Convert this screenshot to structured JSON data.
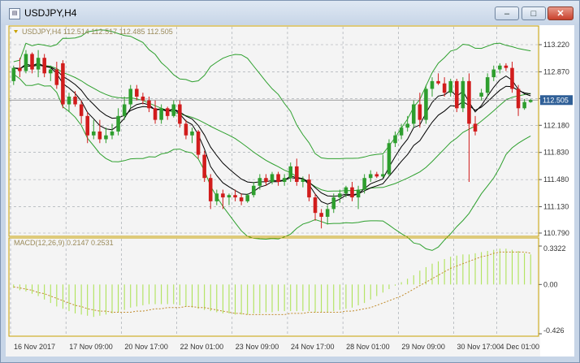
{
  "window": {
    "title": "USDJPY,H4",
    "icon": "chart-window-icon",
    "buttons": [
      "minimize-icon",
      "maximize-icon",
      "close-icon"
    ]
  },
  "main_legend": "USDJPY,H4  112.514 112.517 112.485 112.505",
  "macd_legend": "MACD(12,26,9) 0.2147 0.2531",
  "colors": {
    "bull": "#2e9e2e",
    "bear": "#d11c1c",
    "bands": "#2ea02e",
    "ma": "#000000",
    "macd_hist": "#a8e14a",
    "macd_signal": "#c08a2a",
    "frame": "#c8a000",
    "price_tag": "#2f5f97"
  },
  "chart_data": [
    {
      "type": "candlestick",
      "symbol": "USDJPY",
      "timeframe": "H4",
      "ylim": [
        110.79,
        113.22
      ],
      "yticks": [
        "113.220",
        "112.870",
        "112.525",
        "112.180",
        "111.830",
        "111.480",
        "111.130",
        "110.790"
      ],
      "x_labels": [
        "16 Nov 2017",
        "17 Nov 09:00",
        "20 Nov 17:00",
        "22 Nov 01:00",
        "23 Nov 09:00",
        "24 Nov 17:00",
        "28 Nov 01:00",
        "29 Nov 09:00",
        "30 Nov 17:00",
        "4 Dec 01:00"
      ],
      "current_price": "112.505",
      "grid": true,
      "indicators": [
        "Bollinger Bands",
        "Moving Average",
        "Moving Average"
      ],
      "candles": [
        [
          112.75,
          112.95,
          112.7,
          112.92
        ],
        [
          112.92,
          113.05,
          112.8,
          112.88
        ],
        [
          112.88,
          113.15,
          112.85,
          113.1
        ],
        [
          113.1,
          113.12,
          112.85,
          112.9
        ],
        [
          112.9,
          113.15,
          112.8,
          113.05
        ],
        [
          113.05,
          113.1,
          112.8,
          112.85
        ],
        [
          112.85,
          112.95,
          112.75,
          112.9
        ],
        [
          112.9,
          113.0,
          112.65,
          112.7
        ],
        [
          112.98,
          113.02,
          112.4,
          112.45
        ],
        [
          112.45,
          112.6,
          112.35,
          112.55
        ],
        [
          112.55,
          112.62,
          112.42,
          112.45
        ],
        [
          112.45,
          112.5,
          112.2,
          112.3
        ],
        [
          112.3,
          112.35,
          111.95,
          112.05
        ],
        [
          112.05,
          112.25,
          112.0,
          112.1
        ],
        [
          112.1,
          112.25,
          111.95,
          112.0
        ],
        [
          112.0,
          112.15,
          111.95,
          112.05
        ],
        [
          112.05,
          112.2,
          112.0,
          112.1
        ],
        [
          112.1,
          112.4,
          112.05,
          112.3
        ],
        [
          112.3,
          112.55,
          112.25,
          112.45
        ],
        [
          112.45,
          112.7,
          112.4,
          112.65
        ],
        [
          112.65,
          112.7,
          112.5,
          112.55
        ],
        [
          112.55,
          112.6,
          112.45,
          112.5
        ],
        [
          112.5,
          112.55,
          112.35,
          112.4
        ],
        [
          112.4,
          112.5,
          112.2,
          112.25
        ],
        [
          112.25,
          112.45,
          112.2,
          112.4
        ],
        [
          112.4,
          112.42,
          112.25,
          112.3
        ],
        [
          112.3,
          112.5,
          112.28,
          112.45
        ],
        [
          112.45,
          112.5,
          112.15,
          112.2
        ],
        [
          112.2,
          112.25,
          112.0,
          112.05
        ],
        [
          112.05,
          112.15,
          111.95,
          112.1
        ],
        [
          112.1,
          112.12,
          111.75,
          111.8
        ],
        [
          111.8,
          111.85,
          111.45,
          111.5
        ],
        [
          111.5,
          111.55,
          111.1,
          111.2
        ],
        [
          111.2,
          111.35,
          111.15,
          111.3
        ],
        [
          111.3,
          111.35,
          111.1,
          111.25
        ],
        [
          111.25,
          111.3,
          111.15,
          111.28
        ],
        [
          111.28,
          111.35,
          111.2,
          111.25
        ],
        [
          111.25,
          111.3,
          111.15,
          111.2
        ],
        [
          111.2,
          111.3,
          111.18,
          111.28
        ],
        [
          111.28,
          111.45,
          111.25,
          111.4
        ],
        [
          111.4,
          111.55,
          111.35,
          111.5
        ],
        [
          111.5,
          111.55,
          111.4,
          111.45
        ],
        [
          111.45,
          111.58,
          111.42,
          111.55
        ],
        [
          111.55,
          111.58,
          111.4,
          111.45
        ],
        [
          111.45,
          111.55,
          111.4,
          111.5
        ],
        [
          111.5,
          111.7,
          111.45,
          111.65
        ],
        [
          111.65,
          111.75,
          111.4,
          111.45
        ],
        [
          111.45,
          111.52,
          111.38,
          111.48
        ],
        [
          111.48,
          111.55,
          111.2,
          111.25
        ],
        [
          111.25,
          111.3,
          110.95,
          111.05
        ],
        [
          111.05,
          111.1,
          110.85,
          111.0
        ],
        [
          111.0,
          111.15,
          110.9,
          111.1
        ],
        [
          111.1,
          111.3,
          111.05,
          111.25
        ],
        [
          111.25,
          111.35,
          111.18,
          111.3
        ],
        [
          111.3,
          111.4,
          111.25,
          111.38
        ],
        [
          111.38,
          111.45,
          111.2,
          111.25
        ],
        [
          111.25,
          111.4,
          111.1,
          111.35
        ],
        [
          111.35,
          111.55,
          111.3,
          111.5
        ],
        [
          111.5,
          111.6,
          111.45,
          111.55
        ],
        [
          111.55,
          111.58,
          111.5,
          111.52
        ],
        [
          111.52,
          111.8,
          111.5,
          111.55
        ],
        [
          111.55,
          112.0,
          111.52,
          111.95
        ],
        [
          111.95,
          112.1,
          111.9,
          112.05
        ],
        [
          112.05,
          112.2,
          112.0,
          112.15
        ],
        [
          112.15,
          112.3,
          112.1,
          112.2
        ],
        [
          112.2,
          112.5,
          112.15,
          112.45
        ],
        [
          112.45,
          112.6,
          112.15,
          112.25
        ],
        [
          112.25,
          112.7,
          112.2,
          112.65
        ],
        [
          112.65,
          112.8,
          112.55,
          112.75
        ],
        [
          112.75,
          112.85,
          112.7,
          112.72
        ],
        [
          112.72,
          112.8,
          112.55,
          112.6
        ],
        [
          112.6,
          112.78,
          112.55,
          112.75
        ],
        [
          112.75,
          112.78,
          112.35,
          112.4
        ],
        [
          112.4,
          112.8,
          112.35,
          112.75
        ],
        [
          112.75,
          112.85,
          111.45,
          112.2
        ],
        [
          112.2,
          112.3,
          112.05,
          112.1
        ],
        [
          112.55,
          112.65,
          112.5,
          112.6
        ],
        [
          112.6,
          112.85,
          112.55,
          112.8
        ],
        [
          112.8,
          112.95,
          112.75,
          112.9
        ],
        [
          112.9,
          112.98,
          112.85,
          112.95
        ],
        [
          112.95,
          112.98,
          112.88,
          112.92
        ],
        [
          112.92,
          113.0,
          112.6,
          112.65
        ],
        [
          112.65,
          112.7,
          112.3,
          112.4
        ],
        [
          112.4,
          112.52,
          112.38,
          112.48
        ],
        [
          112.48,
          112.52,
          112.47,
          112.505
        ]
      ]
    },
    {
      "type": "macd",
      "name": "MACD(12,26,9)",
      "ylim": [
        -0.426,
        0.3322
      ],
      "yticks": [
        "0.3322",
        "0.00",
        "-0.426"
      ],
      "macd": [
        -0.03,
        -0.05,
        -0.06,
        -0.08,
        -0.1,
        -0.13,
        -0.16,
        -0.19,
        -0.21,
        -0.23,
        -0.25,
        -0.26,
        -0.27,
        -0.28,
        -0.27,
        -0.26,
        -0.25,
        -0.24,
        -0.22,
        -0.2,
        -0.19,
        -0.18,
        -0.17,
        -0.17,
        -0.17,
        -0.17,
        -0.17,
        -0.18,
        -0.19,
        -0.2,
        -0.21,
        -0.22,
        -0.23,
        -0.24,
        -0.25,
        -0.25,
        -0.26,
        -0.26,
        -0.26,
        -0.25,
        -0.25,
        -0.24,
        -0.24,
        -0.23,
        -0.23,
        -0.23,
        -0.23,
        -0.23,
        -0.23,
        -0.24,
        -0.24,
        -0.24,
        -0.23,
        -0.22,
        -0.21,
        -0.2,
        -0.18,
        -0.16,
        -0.13,
        -0.1,
        -0.07,
        -0.04,
        -0.01,
        0.02,
        0.05,
        0.08,
        0.12,
        0.15,
        0.18,
        0.2,
        0.22,
        0.24,
        0.25,
        0.26,
        0.26,
        0.27,
        0.28,
        0.29,
        0.3,
        0.31,
        0.31,
        0.3,
        0.29,
        0.27,
        0.26
      ],
      "signal": [
        -0.02,
        -0.03,
        -0.04,
        -0.05,
        -0.07,
        -0.08,
        -0.1,
        -0.12,
        -0.14,
        -0.16,
        -0.18,
        -0.19,
        -0.21,
        -0.22,
        -0.23,
        -0.23,
        -0.24,
        -0.24,
        -0.24,
        -0.24,
        -0.23,
        -0.23,
        -0.22,
        -0.21,
        -0.21,
        -0.2,
        -0.2,
        -0.2,
        -0.19,
        -0.19,
        -0.2,
        -0.2,
        -0.21,
        -0.22,
        -0.23,
        -0.24,
        -0.25,
        -0.25,
        -0.26,
        -0.26,
        -0.26,
        -0.26,
        -0.26,
        -0.26,
        -0.26,
        -0.25,
        -0.25,
        -0.25,
        -0.24,
        -0.24,
        -0.24,
        -0.24,
        -0.24,
        -0.24,
        -0.23,
        -0.23,
        -0.22,
        -0.21,
        -0.2,
        -0.18,
        -0.16,
        -0.14,
        -0.12,
        -0.1,
        -0.07,
        -0.04,
        -0.01,
        0.02,
        0.05,
        0.08,
        0.11,
        0.14,
        0.16,
        0.18,
        0.2,
        0.22,
        0.24,
        0.25,
        0.27,
        0.28,
        0.28,
        0.28,
        0.28,
        0.28,
        0.27
      ]
    }
  ]
}
